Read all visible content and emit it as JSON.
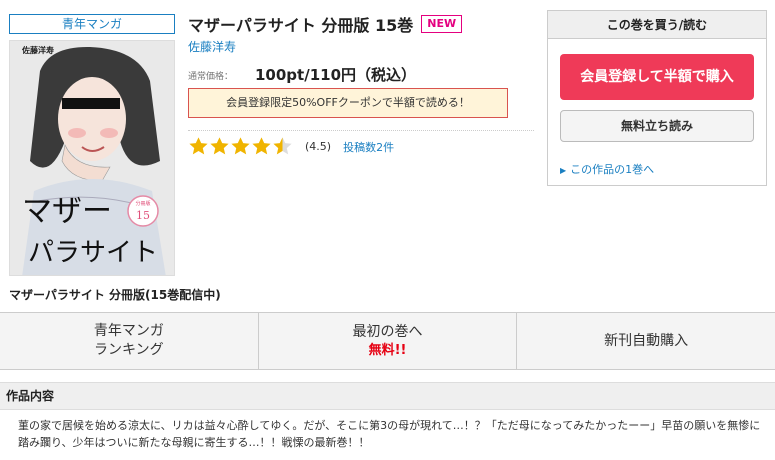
{
  "product": {
    "genre_badge": "青年マンガ",
    "title": "マザーパラサイト 分冊版 15巻",
    "new_label": "NEW",
    "author": "佐藤洋寿",
    "price_label": "通常価格：",
    "price": "100pt/110円（税込）",
    "coupon_text": "会員登録限定50%OFFクーポンで半額で読める！",
    "rating_stars": 4.5,
    "rating_value": "(4.5)",
    "review_count": "投稿数2件",
    "series_name": "マザーパラサイト 分冊版(15巻配信中)"
  },
  "cover": {
    "author_text": "佐藤洋寿",
    "title_line1": "マザー",
    "title_line2": "パラサイト",
    "volume_label": "分冊版",
    "volume_number": "15"
  },
  "buy_box": {
    "heading": "この巻を買う/読む",
    "primary_button": "会員登録して半額で購入",
    "secondary_button": "無料立ち読み",
    "first_volume_link": "この作品の1巻へ"
  },
  "tabs": {
    "ranking_line1": "青年マンガ",
    "ranking_line2": "ランキング",
    "first_volume_line1": "最初の巻へ",
    "first_volume_free": "無料!!",
    "auto_purchase": "新刊自動購入"
  },
  "description": {
    "heading": "作品内容",
    "text": "菫の家で居候を始める涼太に、リカは益々心酔してゆく。だが、そこに第3の母が現れて…！？「ただ母になってみたかったーー」早苗の願いを無惨に踏み躙り、少年はついに新たな母親に寄生する…！！戦慄の最新巻！！"
  },
  "colors": {
    "accent_blue": "#1a7fc1",
    "new_pink": "#e4007f",
    "buy_button_red": "#ef3a58",
    "star_gold": "#f0b400"
  }
}
